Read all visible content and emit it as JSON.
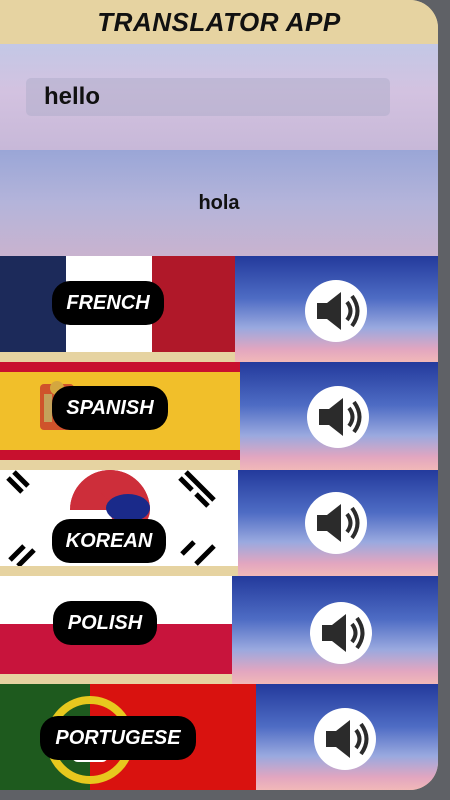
{
  "app": {
    "title": "TRANSLATOR APP"
  },
  "input": {
    "value": "hello"
  },
  "output": {
    "value": "hola"
  },
  "languages": [
    {
      "label": "FRENCH",
      "flag": "france-flag",
      "icon": "speaker-icon"
    },
    {
      "label": "SPANISH",
      "flag": "spain-flag",
      "icon": "speaker-icon"
    },
    {
      "label": "KOREAN",
      "flag": "korea-flag",
      "icon": "speaker-icon"
    },
    {
      "label": "POLISH",
      "flag": "poland-flag",
      "icon": "speaker-icon"
    },
    {
      "label": "PORTUGESE",
      "flag": "portugal-flag",
      "icon": "speaker-icon"
    }
  ],
  "colors": {
    "title_bar": "#e6d3a1",
    "button_bg": "#000000",
    "button_text": "#ffffff"
  }
}
